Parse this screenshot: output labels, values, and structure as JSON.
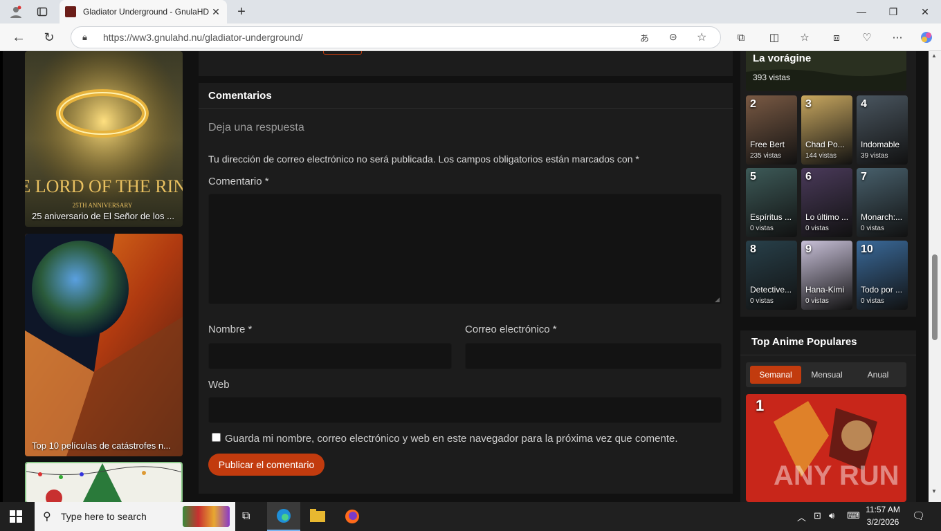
{
  "browser": {
    "tab_title": "Gladiator Underground - GnulaHD",
    "url_host": "https://ww3.gnulahd.nu",
    "url_path": "/gladiator-underground/"
  },
  "left_column": {
    "cards": [
      {
        "caption": "25 aniversario de El Señor de los ..."
      },
      {
        "caption": "Top 10 películas de catástrofes n..."
      }
    ],
    "lotr_art_text": "THE LORD OF THE RINGS",
    "lotr_art_sub": "25TH ANNIVERSARY"
  },
  "comments": {
    "section_title": "Comentarios",
    "reply_title": "Deja una respuesta",
    "notice": "Tu dirección de correo electrónico no será publicada. Los campos obligatorios están marcados con *",
    "comment_label": "Comentario *",
    "name_label": "Nombre *",
    "email_label": "Correo electrónico *",
    "web_label": "Web",
    "save_checkbox_label": "Guarda mi nombre, correo electrónico y web en este navegador para la próxima vez que comente.",
    "submit_label": "Publicar el comentario"
  },
  "right_column": {
    "featured": {
      "title": "La vorágine",
      "views": "393 vistas"
    },
    "items": [
      {
        "num": "2",
        "title": "Free Bert",
        "views": "235 vistas",
        "color": "#7a5a44"
      },
      {
        "num": "3",
        "title": "Chad Po...",
        "views": "144 vistas",
        "color": "#c9a860"
      },
      {
        "num": "4",
        "title": "Indomable",
        "views": "39 vistas",
        "color": "#4a5660"
      },
      {
        "num": "5",
        "title": "Espíritus ...",
        "views": "0 vistas",
        "color": "#3d5a58"
      },
      {
        "num": "6",
        "title": "Lo último ...",
        "views": "0 vistas",
        "color": "#4a3a5a"
      },
      {
        "num": "7",
        "title": "Monarch:...",
        "views": "0 vistas",
        "color": "#48606c"
      },
      {
        "num": "8",
        "title": "Detective...",
        "views": "0 vistas",
        "color": "#28404a"
      },
      {
        "num": "9",
        "title": "Hana-Kimi",
        "views": "0 vistas",
        "color": "#c8c0d8"
      },
      {
        "num": "10",
        "title": "Todo por ...",
        "views": "0 vistas",
        "color": "#3a6a9a"
      }
    ],
    "anime_title": "Top Anime Populares",
    "tabs": [
      "Semanal",
      "Mensual",
      "Anual"
    ],
    "anime_first_num": "1",
    "watermark": "ANY RUN"
  },
  "taskbar": {
    "search_placeholder": "Type here to search",
    "time": "11:57 AM",
    "date": "3/2/2026"
  }
}
